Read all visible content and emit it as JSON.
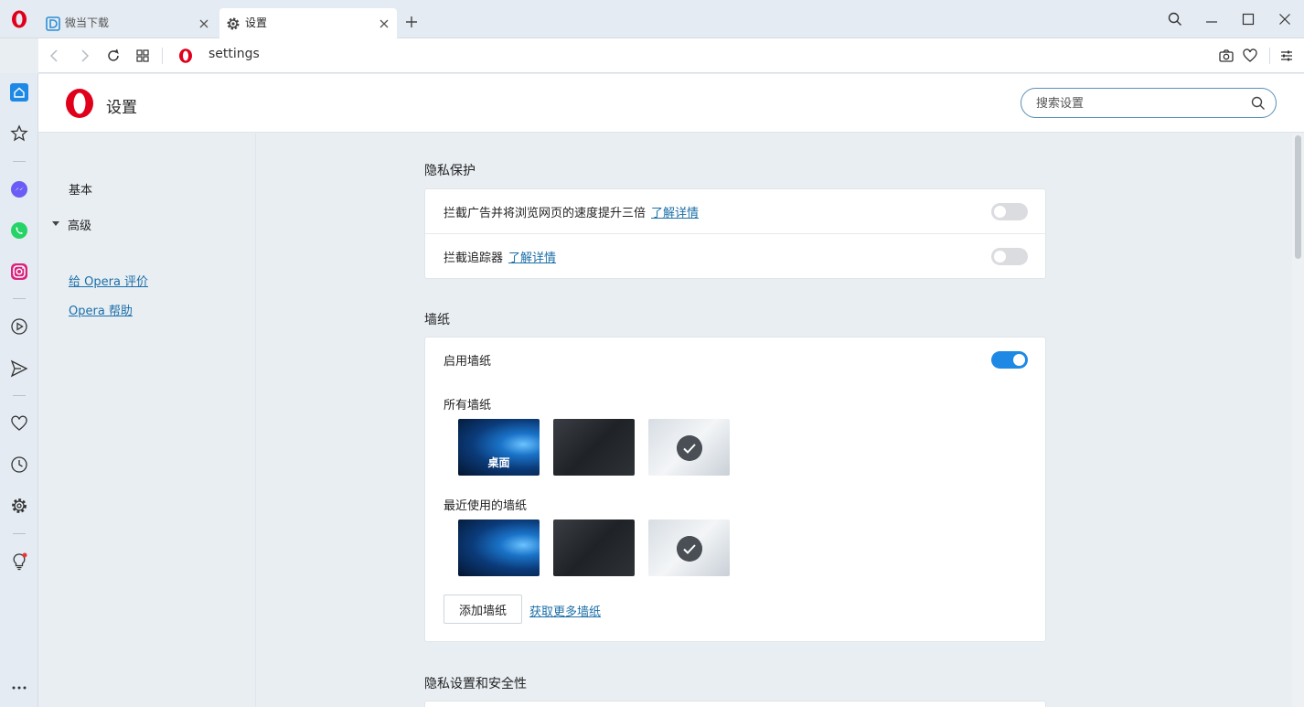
{
  "browser": {
    "tabs": [
      {
        "label": "微当下载",
        "icon": "weidown-favicon"
      },
      {
        "label": "设置",
        "icon": "gear-icon"
      }
    ],
    "address": {
      "url": "settings"
    }
  },
  "header": {
    "title": "设置",
    "search_placeholder": "搜索设置"
  },
  "left_nav": {
    "items": [
      {
        "label": "基本"
      },
      {
        "label": "高级"
      }
    ],
    "links": [
      {
        "label": "给 Opera 评价"
      },
      {
        "label": "Opera 帮助"
      }
    ]
  },
  "sections": {
    "privacy": {
      "title": "隐私保护",
      "rows": [
        {
          "label": "拦截广告并将浏览网页的速度提升三倍",
          "link": "了解详情",
          "enabled": false
        },
        {
          "label": "拦截追踪器",
          "link": "了解详情",
          "enabled": false
        }
      ]
    },
    "wallpaper": {
      "title": "墙纸",
      "enable_label": "启用墙纸",
      "enabled": true,
      "all_label": "所有墙纸",
      "all_thumbs": [
        {
          "kind": "win",
          "caption": "桌面",
          "selected": false
        },
        {
          "kind": "dark",
          "caption": "",
          "selected": false
        },
        {
          "kind": "light",
          "caption": "",
          "selected": true
        }
      ],
      "recent_label": "最近使用的墙纸",
      "recent_thumbs": [
        {
          "kind": "win",
          "caption": "",
          "selected": false
        },
        {
          "kind": "dark",
          "caption": "",
          "selected": false
        },
        {
          "kind": "light",
          "caption": "",
          "selected": true
        }
      ],
      "add_button": "添加墙纸",
      "more_link": "获取更多墙纸"
    },
    "security": {
      "title": "隐私设置和安全性"
    }
  },
  "colors": {
    "accent": "#1e88e5",
    "link": "#1b6fa8",
    "opera_red": "#e0001b"
  }
}
